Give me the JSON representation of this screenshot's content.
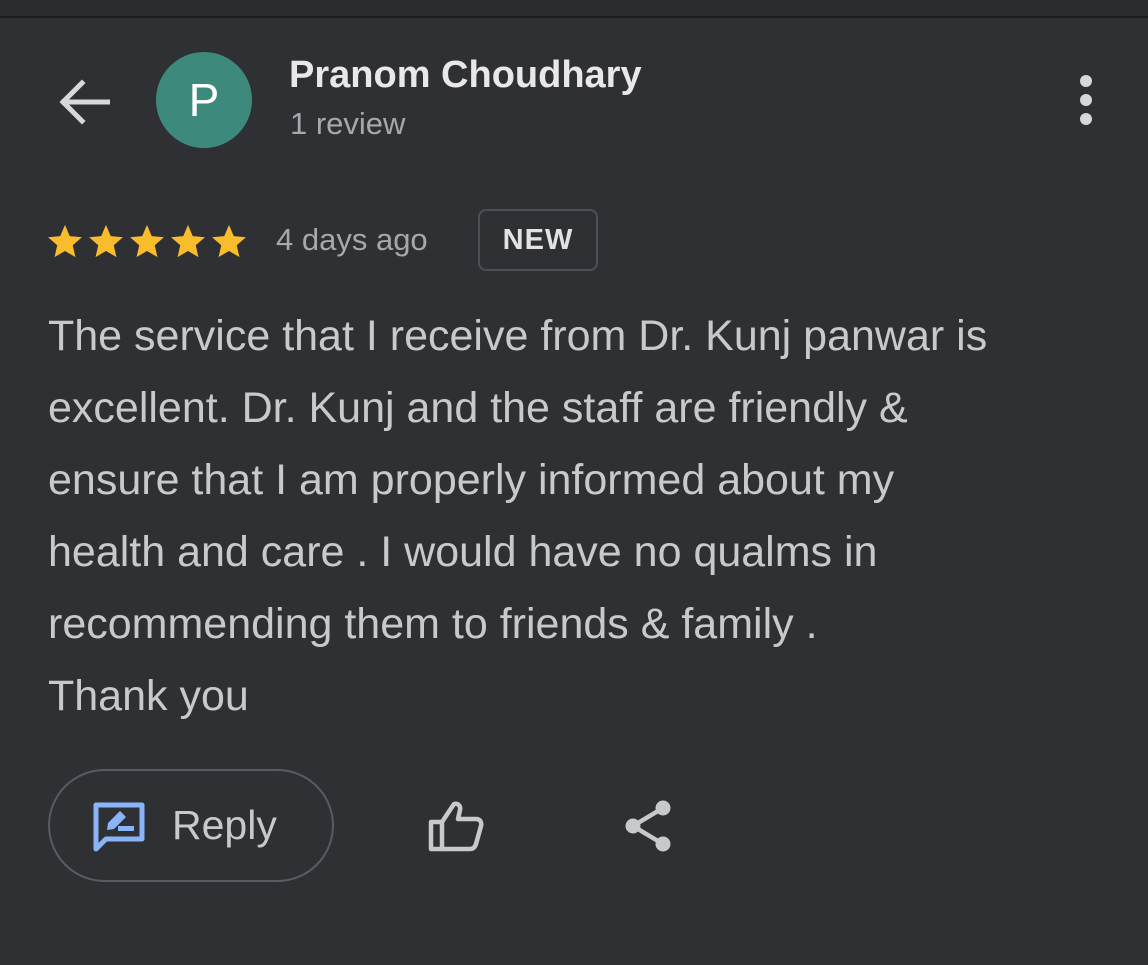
{
  "reviewer": {
    "avatar_letter": "P",
    "name": "Pranom Choudhary",
    "review_count": "1 review"
  },
  "review": {
    "rating": 5,
    "max_rating": 5,
    "time": "4 days ago",
    "badge": "NEW",
    "text": "The service that I receive from Dr. Kunj panwar is\nexcellent. Dr. Kunj and the staff are friendly &\nensure that I am properly informed about my\nhealth and care . I would have no qualms in\nrecommending them to friends & family .\nThank you"
  },
  "actions": {
    "reply_label": "Reply"
  },
  "icons": {
    "back": "arrow-back-icon",
    "more": "more-vert-icon",
    "star": "star-icon",
    "reply": "rate-review-icon",
    "like": "thumb-up-icon",
    "share": "share-icon"
  },
  "colors": {
    "background": "#2f3034",
    "avatar": "#3d8a7c",
    "star": "#f8bc2c",
    "reply_icon": "#8ab4f8",
    "text_primary": "#e8e8ea",
    "text_secondary": "#a7a8ac"
  }
}
